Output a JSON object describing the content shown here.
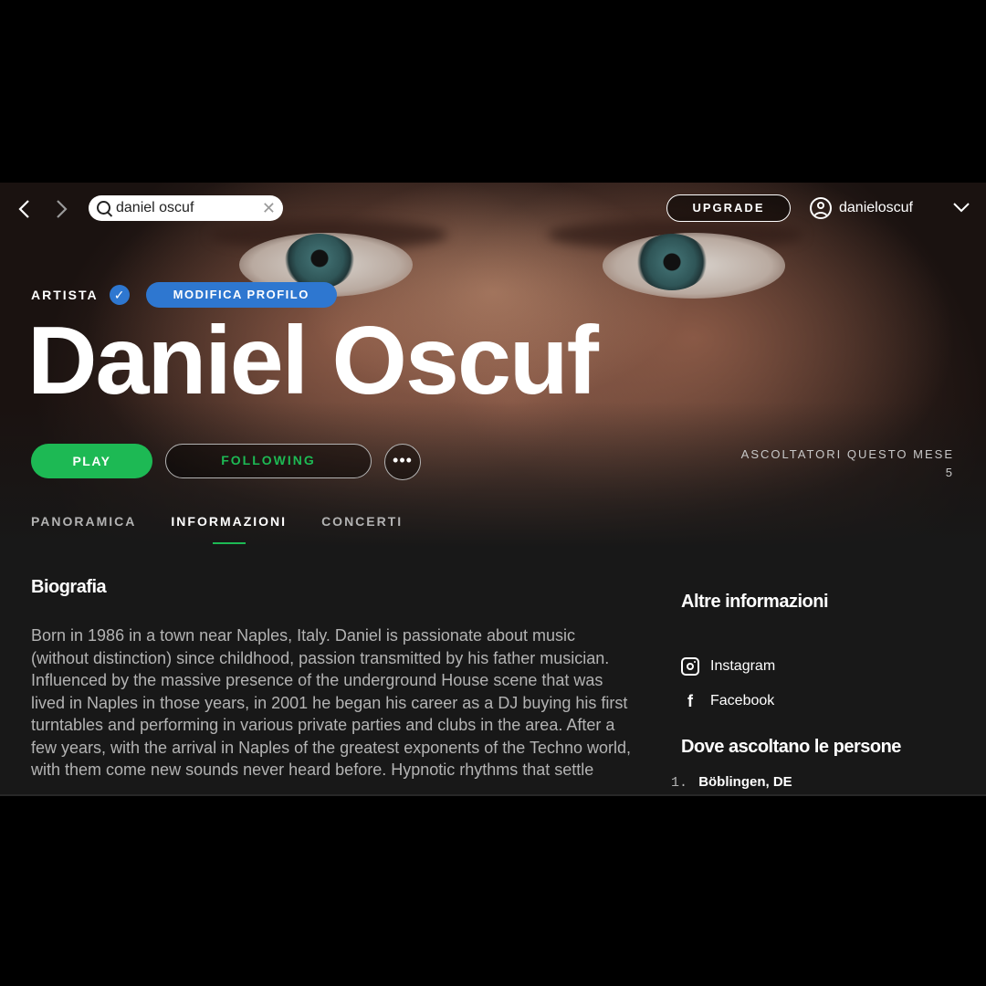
{
  "topbar": {
    "back_icon": "chevron-left-icon",
    "forward_icon": "chevron-right-icon",
    "search_value": "daniel oscuf",
    "upgrade_label": "UPGRADE",
    "username": "danieloscuf"
  },
  "header": {
    "artist_label": "ARTISTA",
    "edit_profile_label": "MODIFICA PROFILO",
    "artist_name": "Daniel Oscuf",
    "play_label": "PLAY",
    "following_label": "FOLLOWING",
    "more_label": "•••",
    "listeners_label": "ASCOLTATORI QUESTO MESE",
    "listeners_value": "5"
  },
  "tabs": [
    {
      "label": "PANORAMICA",
      "active": false
    },
    {
      "label": "INFORMAZIONI",
      "active": true
    },
    {
      "label": "CONCERTI",
      "active": false
    }
  ],
  "bio": {
    "heading": "Biografia",
    "text": "Born in 1986 in a town near Naples, Italy. Daniel is passionate about music (without distinction) since childhood, passion transmitted by his father musician. Influenced by the massive presence of the underground House scene that was lived in Naples in those years, in 2001 he began his career as a DJ buying his first turntables and performing in various private parties and clubs in the area. After a few years, with the arrival in Naples of the greatest exponents of the Techno world, with them come new sounds never heard before. Hypnotic rhythms that settle"
  },
  "side": {
    "heading": "Altre informazioni",
    "links": [
      {
        "label": "Instagram",
        "icon": "instagram-icon"
      },
      {
        "label": "Facebook",
        "icon": "facebook-icon"
      }
    ],
    "where_heading": "Dove ascoltano le persone",
    "where": [
      {
        "rank": "1.",
        "city": "Böblingen, DE"
      }
    ]
  },
  "colors": {
    "accent_green": "#1db954",
    "accent_blue": "#2e77d0",
    "background": "#181818"
  }
}
